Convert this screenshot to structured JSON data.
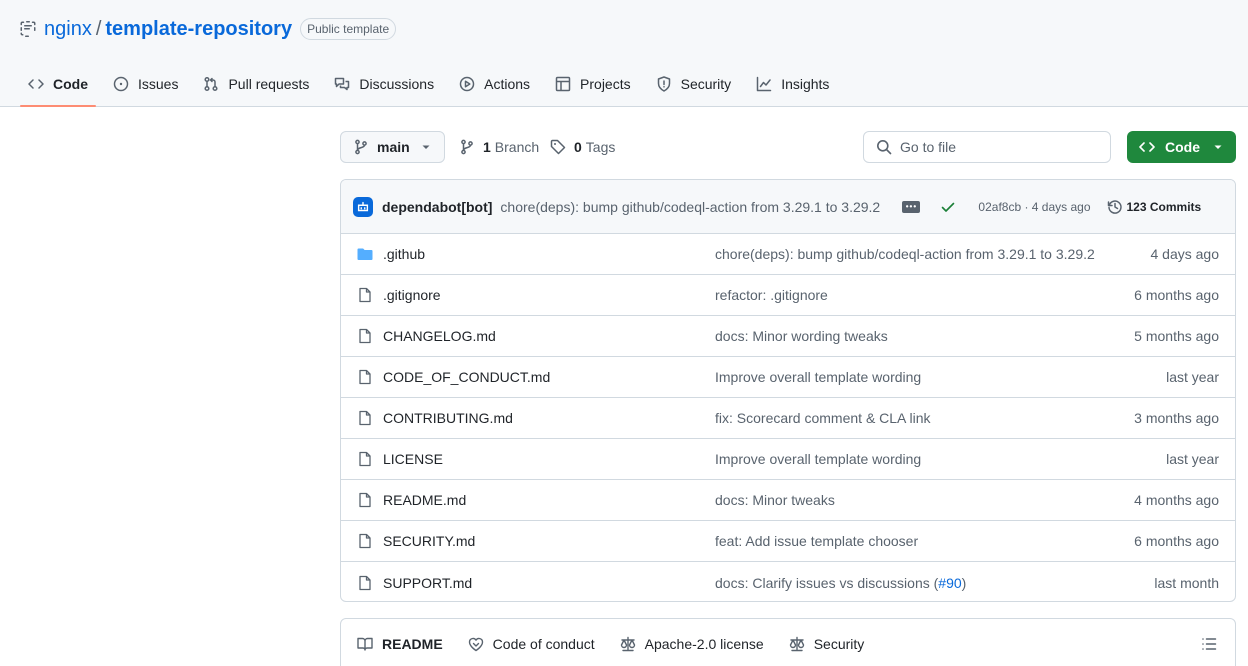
{
  "repo": {
    "owner": "nginx",
    "separator": "/",
    "name": "template-repository",
    "badge": "Public template"
  },
  "tabs": [
    {
      "label": "Code",
      "icon": "code-icon",
      "active": true
    },
    {
      "label": "Issues",
      "icon": "issue-opened-icon"
    },
    {
      "label": "Pull requests",
      "icon": "git-pull-request-icon"
    },
    {
      "label": "Discussions",
      "icon": "comment-discussion-icon"
    },
    {
      "label": "Actions",
      "icon": "play-icon"
    },
    {
      "label": "Projects",
      "icon": "table-icon"
    },
    {
      "label": "Security",
      "icon": "shield-icon"
    },
    {
      "label": "Insights",
      "icon": "graph-icon"
    }
  ],
  "toolbar": {
    "branch": "main",
    "branches_count": "1",
    "branches_label": "Branch",
    "tags_count": "0",
    "tags_label": "Tags",
    "search_placeholder": "Go to file",
    "code_button": "Code"
  },
  "latest_commit": {
    "author": "dependabot[bot]",
    "message": "chore(deps): bump github/codeql-action from 3.29.1 to 3.29.2",
    "sha_time": "02af8cb · 4 days ago",
    "commits": "123 Commits"
  },
  "files": [
    {
      "name": ".github",
      "type": "dir",
      "message": "chore(deps): bump github/codeql-action from 3.29.1 to 3.29.2",
      "age": "4 days ago"
    },
    {
      "name": ".gitignore",
      "type": "file",
      "message": "refactor: .gitignore",
      "age": "6 months ago"
    },
    {
      "name": "CHANGELOG.md",
      "type": "file",
      "message": "docs: Minor wording tweaks",
      "age": "5 months ago"
    },
    {
      "name": "CODE_OF_CONDUCT.md",
      "type": "file",
      "message": "Improve overall template wording",
      "age": "last year"
    },
    {
      "name": "CONTRIBUTING.md",
      "type": "file",
      "message": "fix: Scorecard comment & CLA link",
      "age": "3 months ago"
    },
    {
      "name": "LICENSE",
      "type": "file",
      "message": "Improve overall template wording",
      "age": "last year"
    },
    {
      "name": "README.md",
      "type": "file",
      "message": "docs: Minor tweaks",
      "age": "4 months ago"
    },
    {
      "name": "SECURITY.md",
      "type": "file",
      "message": "feat: Add issue template chooser",
      "age": "6 months ago"
    },
    {
      "name": "SUPPORT.md",
      "type": "file",
      "message": "docs: Clarify issues vs discussions (",
      "link": "#90",
      "message_end": ")",
      "age": "last month"
    }
  ],
  "readme_tabs": [
    {
      "label": "README",
      "icon": "book-icon",
      "active": true
    },
    {
      "label": "Code of conduct",
      "icon": "code-of-conduct-icon"
    },
    {
      "label": "Apache-2.0 license",
      "icon": "law-icon"
    },
    {
      "label": "Security",
      "icon": "law-icon"
    }
  ],
  "colors": {
    "accent": "#0969da",
    "primary_button": "#1f883d",
    "tab_underline": "#fd8c73",
    "folder": "#54aeff",
    "success": "#1a7f37"
  }
}
